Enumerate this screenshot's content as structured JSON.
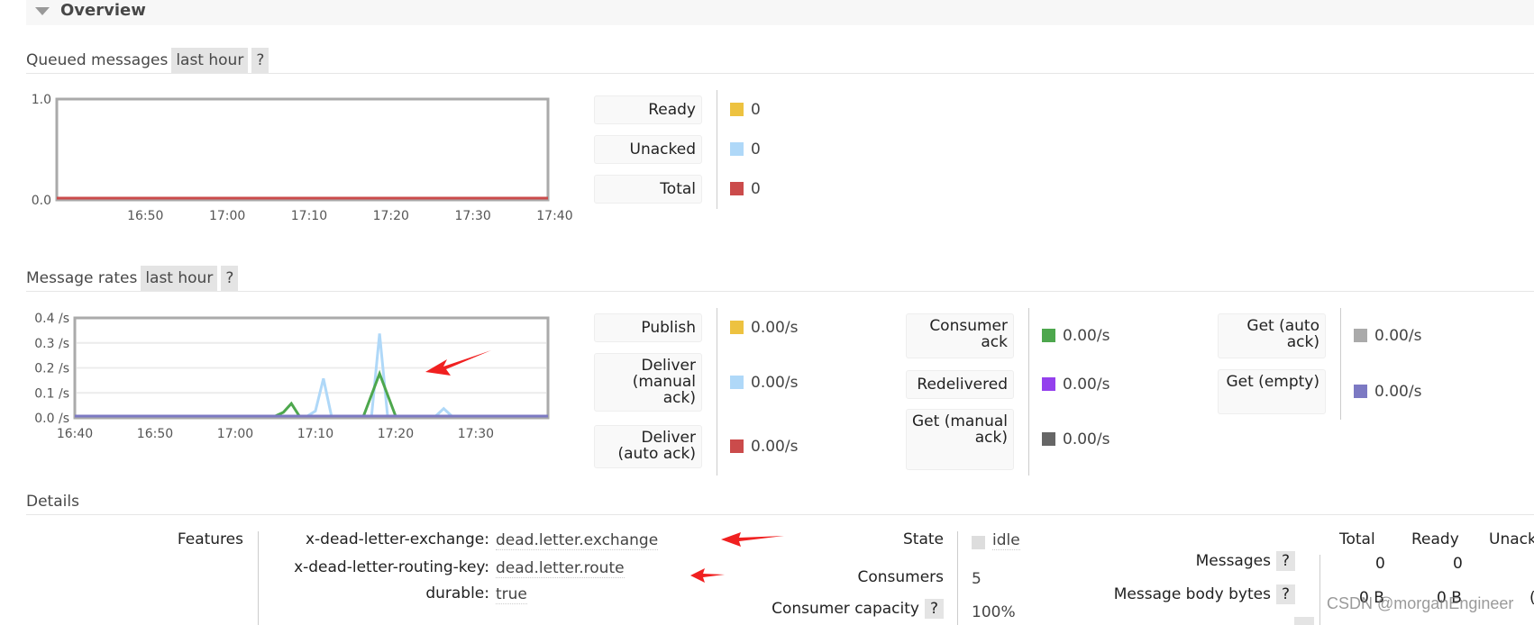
{
  "overview": {
    "title": "Overview"
  },
  "queued": {
    "title": "Queued messages",
    "range": "last hour",
    "help": "?",
    "legend": [
      {
        "label": "Ready",
        "value": "0",
        "color": "#edc240"
      },
      {
        "label": "Unacked",
        "value": "0",
        "color": "#afd8f8"
      },
      {
        "label": "Total",
        "value": "0",
        "color": "#cb4b4b"
      }
    ]
  },
  "rates": {
    "title": "Message rates",
    "range": "last hour",
    "help": "?",
    "legend_col1": [
      {
        "label": "Publish",
        "value": "0.00/s",
        "color": "#edc240"
      },
      {
        "label": "Deliver (manual ack)",
        "value": "0.00/s",
        "color": "#afd8f8"
      },
      {
        "label": "Deliver (auto ack)",
        "value": "0.00/s",
        "color": "#cb4b4b"
      }
    ],
    "legend_col2": [
      {
        "label": "Consumer ack",
        "value": "0.00/s",
        "color": "#4da74d"
      },
      {
        "label": "Redelivered",
        "value": "0.00/s",
        "color": "#9440ed"
      },
      {
        "label": "Get (manual ack)",
        "value": "0.00/s",
        "color": "#666666"
      }
    ],
    "legend_col3": [
      {
        "label": "Get (auto ack)",
        "value": "0.00/s",
        "color": "#aaaaaa"
      },
      {
        "label": "Get (empty)",
        "value": "0.00/s",
        "color": "#7c79c3"
      }
    ]
  },
  "chart_data": [
    {
      "type": "line",
      "title": "Queued messages",
      "x_ticks": [
        "16:50",
        "17:00",
        "17:10",
        "17:20",
        "17:30",
        "17:40"
      ],
      "x_range_minutes": [
        0,
        60
      ],
      "x_start": "16:40",
      "y_ticks": [
        "0.0",
        "1.0"
      ],
      "ylim": [
        0,
        1
      ],
      "series": [
        {
          "name": "Ready",
          "color": "#edc240",
          "x": [
            0,
            60
          ],
          "y": [
            0,
            0
          ]
        },
        {
          "name": "Unacked",
          "color": "#afd8f8",
          "x": [
            0,
            60
          ],
          "y": [
            0,
            0
          ]
        },
        {
          "name": "Total",
          "color": "#cb4b4b",
          "x": [
            0,
            60
          ],
          "y": [
            0,
            0
          ]
        }
      ]
    },
    {
      "type": "line",
      "title": "Message rates",
      "x_ticks": [
        "16:40",
        "16:50",
        "17:00",
        "17:10",
        "17:20",
        "17:30"
      ],
      "x_range_minutes": [
        0,
        59
      ],
      "x_start": "16:40",
      "y_ticks": [
        "0.0 /s",
        "0.1 /s",
        "0.2 /s",
        "0.3 /s",
        "0.4 /s"
      ],
      "ylim": [
        0,
        0.4
      ],
      "grid": true,
      "series": [
        {
          "name": "Deliver (manual ack)",
          "color": "#afd8f8",
          "x": [
            0,
            28,
            29,
            30,
            31,
            32,
            37,
            38,
            39,
            45,
            46,
            47,
            59
          ],
          "y": [
            0,
            0,
            0,
            0.02,
            0.15,
            0,
            0,
            0.33,
            0,
            0,
            0.03,
            0,
            0
          ]
        },
        {
          "name": "Consumer ack",
          "color": "#4da74d",
          "x": [
            0,
            25,
            26,
            27,
            28,
            36,
            38,
            40,
            59
          ],
          "y": [
            0,
            0,
            0.015,
            0.05,
            0,
            0,
            0.17,
            0,
            0
          ]
        },
        {
          "name": "Get (empty)",
          "color": "#7c79c3",
          "x": [
            0,
            59
          ],
          "y": [
            0,
            0
          ]
        }
      ]
    }
  ],
  "details": {
    "title": "Details",
    "features_label": "Features",
    "features": [
      {
        "key": "x-dead-letter-exchange:",
        "value": "dead.letter.exchange"
      },
      {
        "key": "x-dead-letter-routing-key:",
        "value": "dead.letter.route"
      },
      {
        "key": "durable:",
        "value": "true"
      }
    ],
    "state_label": "State",
    "state_value": "idle",
    "consumers_label": "Consumers",
    "consumers_value": "5",
    "capacity_label": "Consumer capacity",
    "capacity_value": "100%",
    "help": "?",
    "table": {
      "headers": [
        "Total",
        "Ready",
        "Unack"
      ],
      "rows": [
        {
          "label": "Messages",
          "values": [
            "0",
            "0",
            ""
          ]
        },
        {
          "label": "Message body bytes",
          "values": [
            "0 B",
            "0 B",
            "("
          ]
        }
      ]
    }
  },
  "watermark": "CSDN @morganEngineer"
}
